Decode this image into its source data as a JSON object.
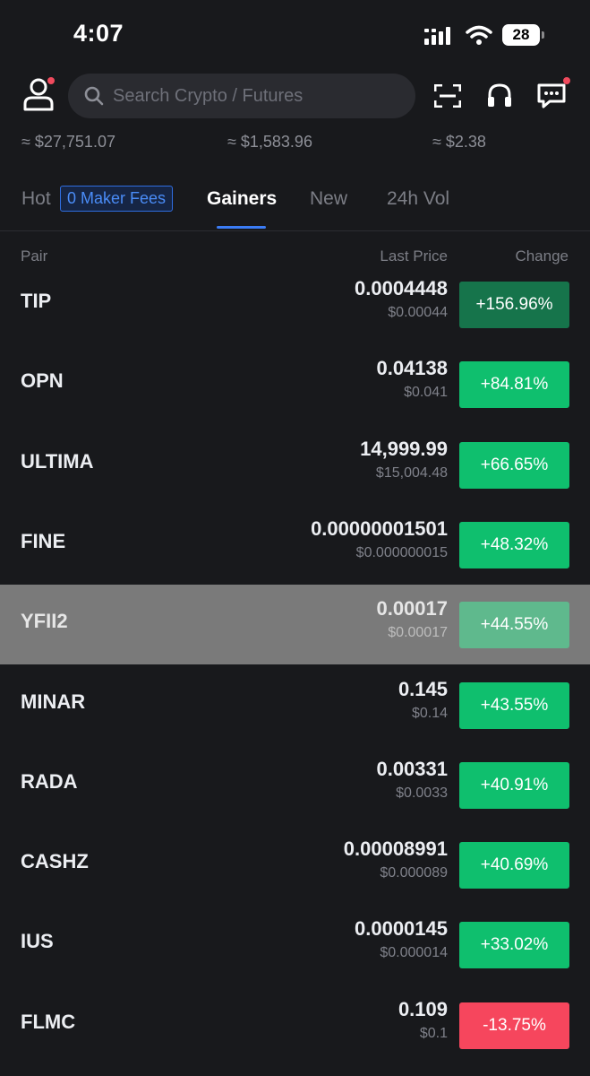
{
  "status_bar": {
    "time": "4:07",
    "battery": "28"
  },
  "search": {
    "placeholder": "Search Crypto / Futures"
  },
  "tickers": [
    "≈ $27,751.07",
    "≈ $1,583.96",
    "≈ $2.38"
  ],
  "tabs": [
    {
      "label": "Hot"
    },
    {
      "label": "Gainers"
    },
    {
      "label": "New"
    },
    {
      "label": "24h Vol"
    }
  ],
  "hot_badge": "0 Maker Fees",
  "columns": {
    "pair": "Pair",
    "last_price": "Last Price",
    "change": "Change"
  },
  "colors": {
    "up": "#0fbf6e",
    "up_faded": "#16744b",
    "up_highlight": "#5fb98d",
    "down": "#f6465d",
    "accent": "#3b7cf5"
  },
  "rows": [
    {
      "pair": "TIP",
      "price": "0.0004448",
      "usd": "$0.00044",
      "change": "+156.96%",
      "trend": "up_faded"
    },
    {
      "pair": "OPN",
      "price": "0.04138",
      "usd": "$0.041",
      "change": "+84.81%",
      "trend": "up"
    },
    {
      "pair": "ULTIMA",
      "price": "14,999.99",
      "usd": "$15,004.48",
      "change": "+66.65%",
      "trend": "up"
    },
    {
      "pair": "FINE",
      "price": "0.00000001501",
      "usd": "$0.000000015",
      "change": "+48.32%",
      "trend": "up"
    },
    {
      "pair": "YFII2",
      "price": "0.00017",
      "usd": "$0.00017",
      "change": "+44.55%",
      "trend": "up_highlight"
    },
    {
      "pair": "MINAR",
      "price": "0.145",
      "usd": "$0.14",
      "change": "+43.55%",
      "trend": "up"
    },
    {
      "pair": "RADA",
      "price": "0.00331",
      "usd": "$0.0033",
      "change": "+40.91%",
      "trend": "up"
    },
    {
      "pair": "CASHZ",
      "price": "0.00008991",
      "usd": "$0.000089",
      "change": "+40.69%",
      "trend": "up"
    },
    {
      "pair": "IUS",
      "price": "0.0000145",
      "usd": "$0.000014",
      "change": "+33.02%",
      "trend": "up"
    },
    {
      "pair": "FLMC",
      "price": "0.109",
      "usd": "$0.1",
      "change": "-13.75%",
      "trend": "down"
    }
  ]
}
